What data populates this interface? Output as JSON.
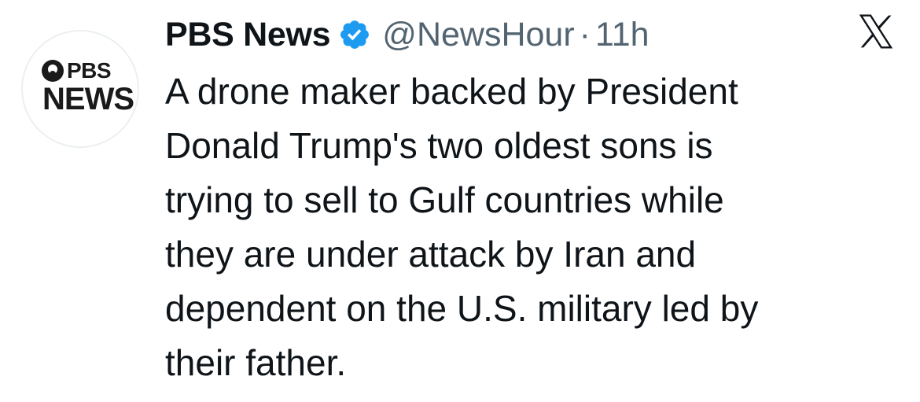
{
  "account": {
    "display_name": "PBS News",
    "handle": "@NewsHour",
    "separator": "·",
    "time": "11h",
    "avatar": {
      "line1": "PBS",
      "line2": "NEWS"
    }
  },
  "tweet": {
    "lines": [
      "A drone maker backed by President",
      "Donald Trump's two oldest sons is",
      "trying to sell to Gulf countries while",
      "they are under attack by Iran and",
      "dependent on the U.S. military led by",
      "their father."
    ]
  },
  "icons": {
    "verified": "verified-badge-icon",
    "platform": "x-logo-icon"
  },
  "colors": {
    "text_primary": "#0f1419",
    "text_secondary": "#536471",
    "verified_blue": "#1d9bf0",
    "background": "#ffffff"
  }
}
